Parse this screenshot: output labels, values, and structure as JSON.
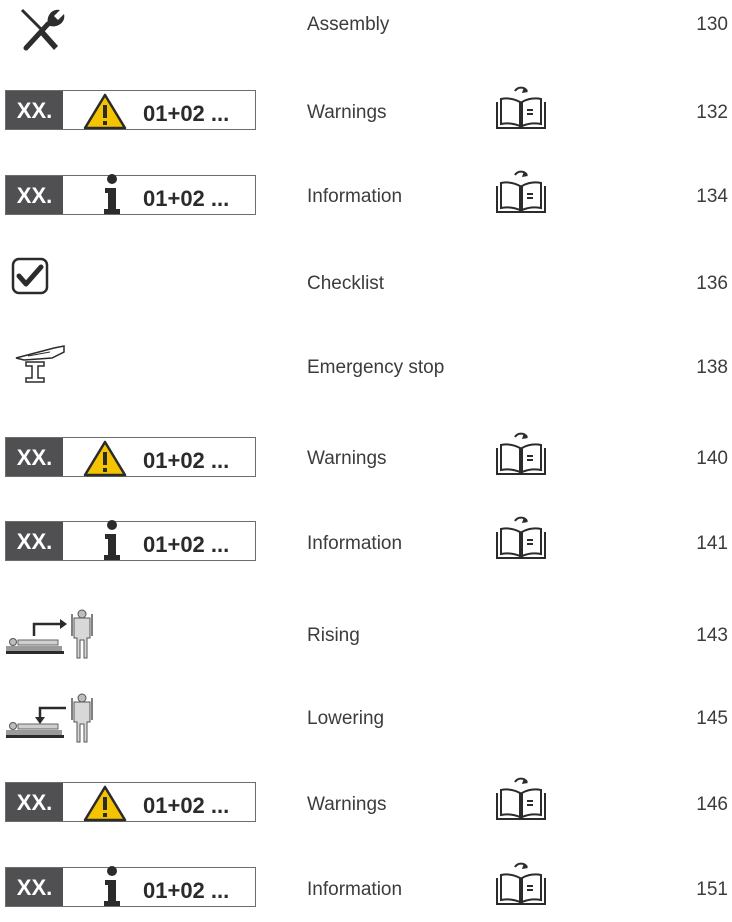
{
  "badge": {
    "prefix": "XX.",
    "code": "01+02 ..."
  },
  "rows": [
    {
      "kind": "tool",
      "icon": "wrench-screwdriver-icon",
      "label": "Assembly",
      "page": "130"
    },
    {
      "kind": "warning",
      "icon": "warning-triangle-icon",
      "label": "Warnings",
      "page": "132",
      "book": "manual-book-icon"
    },
    {
      "kind": "info",
      "icon": "info-icon",
      "label": "Information",
      "page": "134",
      "book": "manual-book-icon"
    },
    {
      "kind": "check",
      "icon": "checkbox-checked-icon",
      "label": "Checklist",
      "page": "136"
    },
    {
      "kind": "estop",
      "icon": "emergency-stop-lever-icon",
      "label": "Emergency stop",
      "page": "138"
    },
    {
      "kind": "warning",
      "icon": "warning-triangle-icon",
      "label": "Warnings",
      "page": "140",
      "book": "manual-book-icon"
    },
    {
      "kind": "info",
      "icon": "info-icon",
      "label": "Information",
      "page": "141",
      "book": "manual-book-icon"
    },
    {
      "kind": "rise",
      "icon": "patient-rising-icon",
      "label": "Rising",
      "page": "143"
    },
    {
      "kind": "lower",
      "icon": "patient-lowering-icon",
      "label": "Lowering",
      "page": "145"
    },
    {
      "kind": "warning",
      "icon": "warning-triangle-icon",
      "label": "Warnings",
      "page": "146",
      "book": "manual-book-icon"
    },
    {
      "kind": "info",
      "icon": "info-icon",
      "label": "Information",
      "page": "151",
      "book": "manual-book-icon"
    }
  ],
  "colors": {
    "badge_dark": "#505052",
    "warning_yellow": "#f4c400",
    "text": "#3c3c3c"
  }
}
